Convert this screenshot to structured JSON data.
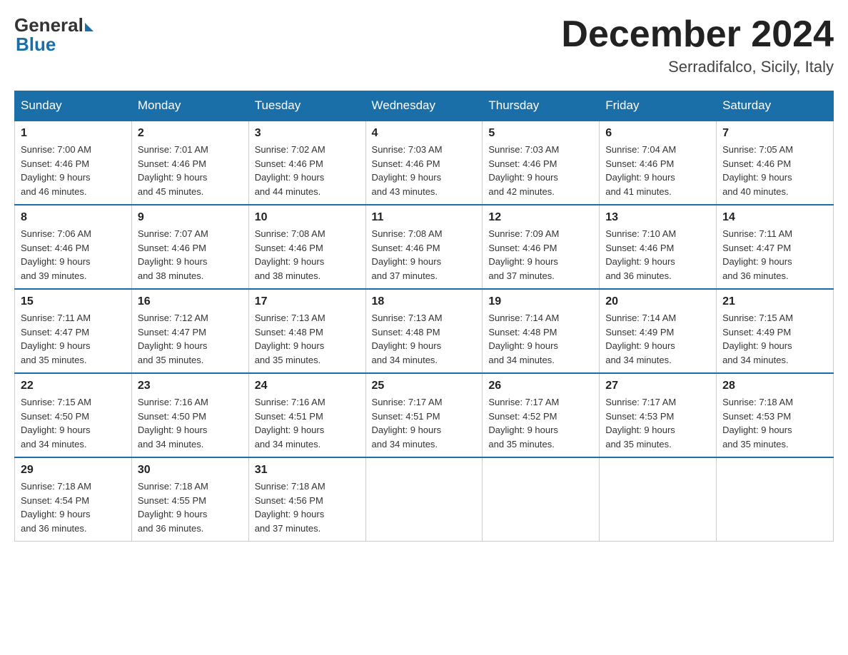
{
  "header": {
    "logo_general": "General",
    "logo_blue": "Blue",
    "month_title": "December 2024",
    "location": "Serradifalco, Sicily, Italy"
  },
  "days_of_week": [
    "Sunday",
    "Monday",
    "Tuesday",
    "Wednesday",
    "Thursday",
    "Friday",
    "Saturday"
  ],
  "weeks": [
    [
      {
        "day": "1",
        "sunrise": "7:00 AM",
        "sunset": "4:46 PM",
        "daylight": "9 hours and 46 minutes."
      },
      {
        "day": "2",
        "sunrise": "7:01 AM",
        "sunset": "4:46 PM",
        "daylight": "9 hours and 45 minutes."
      },
      {
        "day": "3",
        "sunrise": "7:02 AM",
        "sunset": "4:46 PM",
        "daylight": "9 hours and 44 minutes."
      },
      {
        "day": "4",
        "sunrise": "7:03 AM",
        "sunset": "4:46 PM",
        "daylight": "9 hours and 43 minutes."
      },
      {
        "day": "5",
        "sunrise": "7:03 AM",
        "sunset": "4:46 PM",
        "daylight": "9 hours and 42 minutes."
      },
      {
        "day": "6",
        "sunrise": "7:04 AM",
        "sunset": "4:46 PM",
        "daylight": "9 hours and 41 minutes."
      },
      {
        "day": "7",
        "sunrise": "7:05 AM",
        "sunset": "4:46 PM",
        "daylight": "9 hours and 40 minutes."
      }
    ],
    [
      {
        "day": "8",
        "sunrise": "7:06 AM",
        "sunset": "4:46 PM",
        "daylight": "9 hours and 39 minutes."
      },
      {
        "day": "9",
        "sunrise": "7:07 AM",
        "sunset": "4:46 PM",
        "daylight": "9 hours and 38 minutes."
      },
      {
        "day": "10",
        "sunrise": "7:08 AM",
        "sunset": "4:46 PM",
        "daylight": "9 hours and 38 minutes."
      },
      {
        "day": "11",
        "sunrise": "7:08 AM",
        "sunset": "4:46 PM",
        "daylight": "9 hours and 37 minutes."
      },
      {
        "day": "12",
        "sunrise": "7:09 AM",
        "sunset": "4:46 PM",
        "daylight": "9 hours and 37 minutes."
      },
      {
        "day": "13",
        "sunrise": "7:10 AM",
        "sunset": "4:46 PM",
        "daylight": "9 hours and 36 minutes."
      },
      {
        "day": "14",
        "sunrise": "7:11 AM",
        "sunset": "4:47 PM",
        "daylight": "9 hours and 36 minutes."
      }
    ],
    [
      {
        "day": "15",
        "sunrise": "7:11 AM",
        "sunset": "4:47 PM",
        "daylight": "9 hours and 35 minutes."
      },
      {
        "day": "16",
        "sunrise": "7:12 AM",
        "sunset": "4:47 PM",
        "daylight": "9 hours and 35 minutes."
      },
      {
        "day": "17",
        "sunrise": "7:13 AM",
        "sunset": "4:48 PM",
        "daylight": "9 hours and 35 minutes."
      },
      {
        "day": "18",
        "sunrise": "7:13 AM",
        "sunset": "4:48 PM",
        "daylight": "9 hours and 34 minutes."
      },
      {
        "day": "19",
        "sunrise": "7:14 AM",
        "sunset": "4:48 PM",
        "daylight": "9 hours and 34 minutes."
      },
      {
        "day": "20",
        "sunrise": "7:14 AM",
        "sunset": "4:49 PM",
        "daylight": "9 hours and 34 minutes."
      },
      {
        "day": "21",
        "sunrise": "7:15 AM",
        "sunset": "4:49 PM",
        "daylight": "9 hours and 34 minutes."
      }
    ],
    [
      {
        "day": "22",
        "sunrise": "7:15 AM",
        "sunset": "4:50 PM",
        "daylight": "9 hours and 34 minutes."
      },
      {
        "day": "23",
        "sunrise": "7:16 AM",
        "sunset": "4:50 PM",
        "daylight": "9 hours and 34 minutes."
      },
      {
        "day": "24",
        "sunrise": "7:16 AM",
        "sunset": "4:51 PM",
        "daylight": "9 hours and 34 minutes."
      },
      {
        "day": "25",
        "sunrise": "7:17 AM",
        "sunset": "4:51 PM",
        "daylight": "9 hours and 34 minutes."
      },
      {
        "day": "26",
        "sunrise": "7:17 AM",
        "sunset": "4:52 PM",
        "daylight": "9 hours and 35 minutes."
      },
      {
        "day": "27",
        "sunrise": "7:17 AM",
        "sunset": "4:53 PM",
        "daylight": "9 hours and 35 minutes."
      },
      {
        "day": "28",
        "sunrise": "7:18 AM",
        "sunset": "4:53 PM",
        "daylight": "9 hours and 35 minutes."
      }
    ],
    [
      {
        "day": "29",
        "sunrise": "7:18 AM",
        "sunset": "4:54 PM",
        "daylight": "9 hours and 36 minutes."
      },
      {
        "day": "30",
        "sunrise": "7:18 AM",
        "sunset": "4:55 PM",
        "daylight": "9 hours and 36 minutes."
      },
      {
        "day": "31",
        "sunrise": "7:18 AM",
        "sunset": "4:56 PM",
        "daylight": "9 hours and 37 minutes."
      },
      null,
      null,
      null,
      null
    ]
  ]
}
